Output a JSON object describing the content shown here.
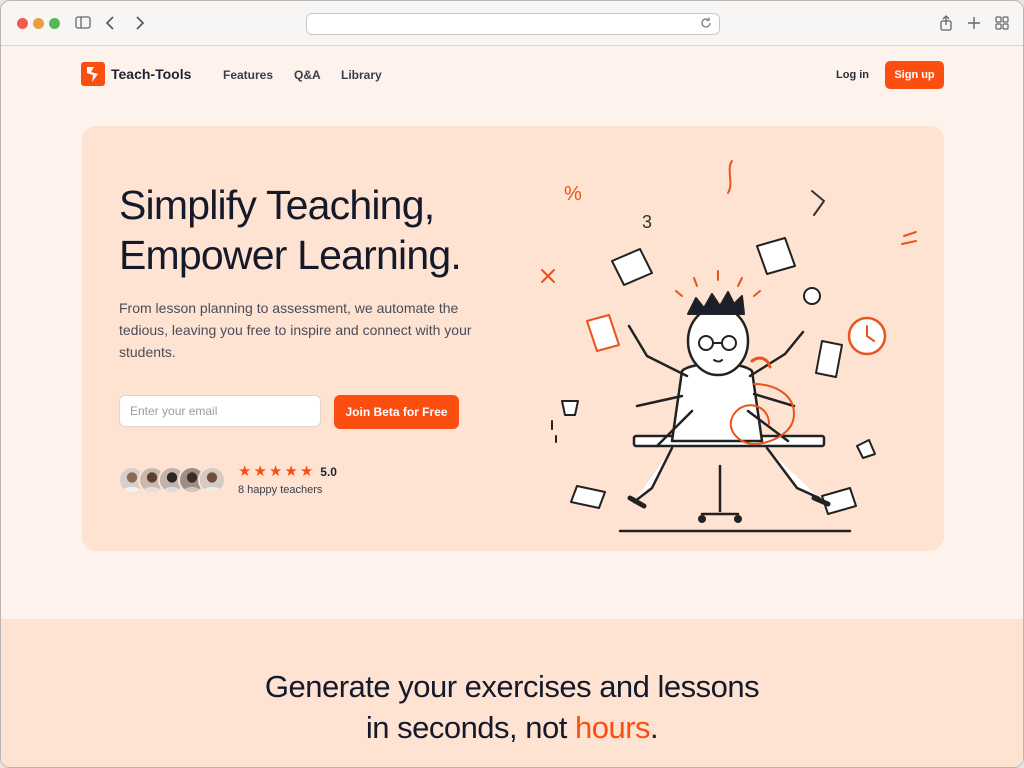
{
  "browser": {
    "url": ""
  },
  "nav": {
    "brand": "Teach-Tools",
    "links": [
      "Features",
      "Q&A",
      "Library"
    ],
    "login": "Log in",
    "signup": "Sign up"
  },
  "hero": {
    "title_line1": "Simplify Teaching,",
    "title_line2": "Empower Learning.",
    "subtitle": "From lesson planning to assessment, we automate the tedious, leaving you free to inspire and connect with your students.",
    "email_placeholder": "Enter your email",
    "cta": "Join Beta for Free",
    "rating": "5.0",
    "rating_stars": 5,
    "teachers": "8 happy teachers"
  },
  "band": {
    "line1": "Generate your exercises and lessons",
    "line2_prefix": "in seconds, not ",
    "line2_accent": "hours",
    "line2_suffix": "."
  },
  "colors": {
    "accent": "#fb4f12",
    "hero_bg": "#fee3d3",
    "page_bg": "#fdf3ec",
    "text_dark": "#141a2a"
  }
}
